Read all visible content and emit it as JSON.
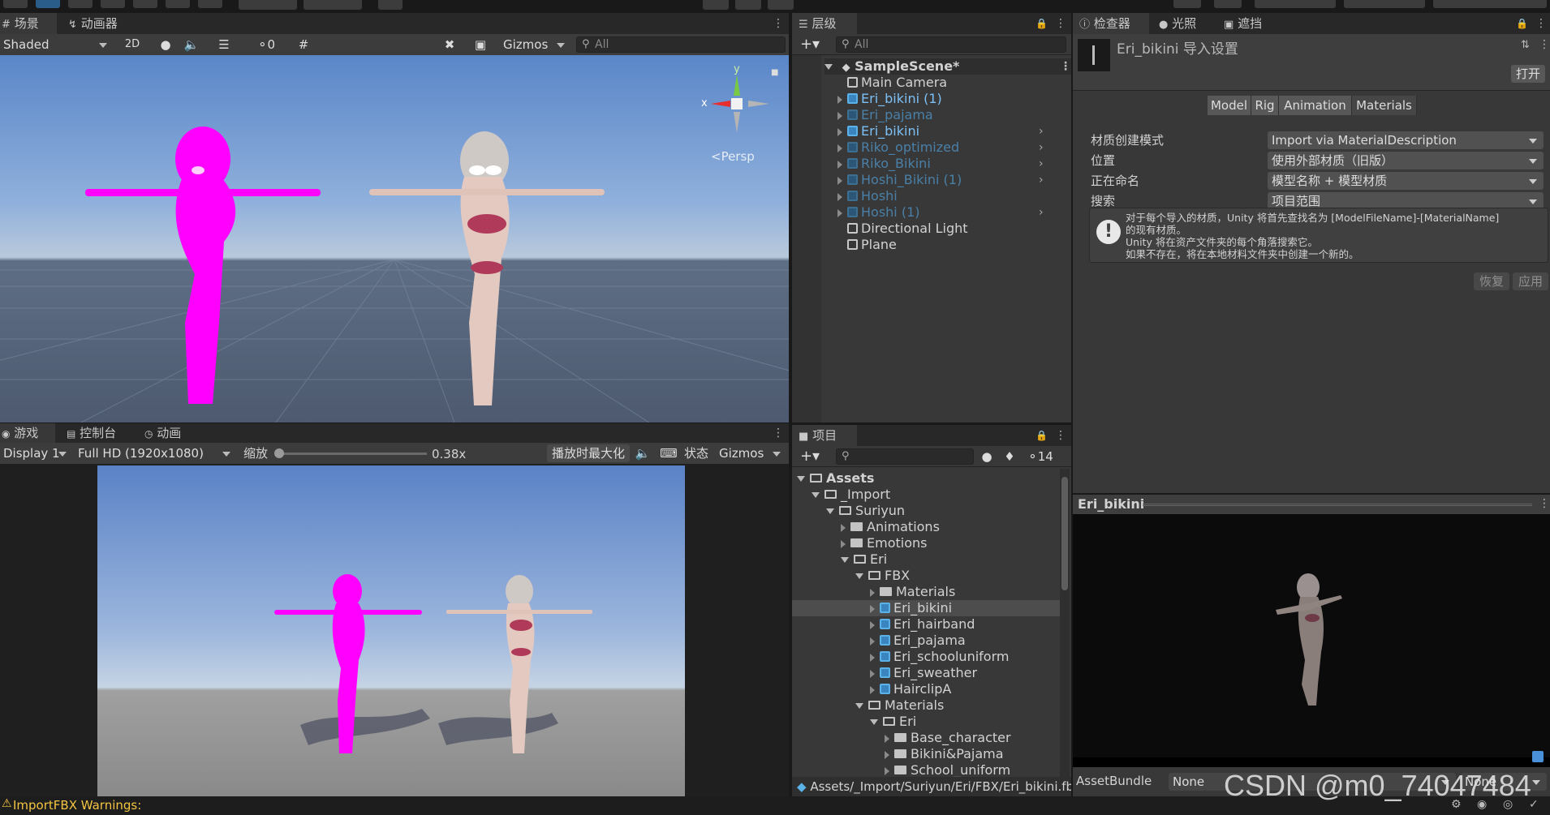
{
  "scene": {
    "tab_scene": "场景",
    "tab_animator": "动画器",
    "shading": "Shaded",
    "btn_2d": "2D",
    "hidden_count": "0",
    "gizmos": "Gizmos",
    "search_placeholder": "All",
    "persp": "<Persp",
    "axis_x": "x",
    "axis_y": "y"
  },
  "game": {
    "tab_game": "游戏",
    "tab_console": "控制台",
    "tab_animation": "动画",
    "display": "Display 1",
    "resolution": "Full HD (1920x1080)",
    "scale_label": "缩放",
    "scale_value": "0.38x",
    "scale_fraction": 0.0,
    "maximize": "播放时最大化",
    "stats": "状态",
    "gizmos": "Gizmos"
  },
  "hierarchy": {
    "tab": "层级",
    "search_placeholder": "All",
    "scene_name": "SampleScene*",
    "items": [
      {
        "label": "Main Camera",
        "style": "normal",
        "arrow": false
      },
      {
        "label": "Eri_bikini (1)",
        "style": "blue",
        "arrow": true
      },
      {
        "label": "Eri_pajama",
        "style": "dim",
        "arrow": true
      },
      {
        "label": "Eri_bikini",
        "style": "blue",
        "arrow": true
      },
      {
        "label": "Riko_optimized",
        "style": "dim",
        "arrow": true
      },
      {
        "label": "Riko_Bikini",
        "style": "dim",
        "arrow": true
      },
      {
        "label": "Hoshi_Bikini (1)",
        "style": "dim",
        "arrow": true
      },
      {
        "label": "Hoshi",
        "style": "dim",
        "arrow": true
      },
      {
        "label": "Hoshi (1)",
        "style": "dim",
        "arrow": true
      },
      {
        "label": "Directional Light",
        "style": "normal",
        "arrow": false
      },
      {
        "label": "Plane",
        "style": "normal",
        "arrow": false
      }
    ]
  },
  "project": {
    "tab": "项目",
    "hidden_count": "14",
    "tree": [
      {
        "label": "Assets",
        "depth": 0,
        "open": true,
        "icon": "folder",
        "bold": true
      },
      {
        "label": "_Import",
        "depth": 1,
        "open": true,
        "icon": "folder"
      },
      {
        "label": "Suriyun",
        "depth": 2,
        "open": true,
        "icon": "folder"
      },
      {
        "label": "Animations",
        "depth": 3,
        "open": false,
        "icon": "folder"
      },
      {
        "label": "Emotions",
        "depth": 3,
        "open": false,
        "icon": "folder"
      },
      {
        "label": "Eri",
        "depth": 3,
        "open": true,
        "icon": "folder"
      },
      {
        "label": "FBX",
        "depth": 4,
        "open": true,
        "icon": "folder"
      },
      {
        "label": "Materials",
        "depth": 5,
        "open": false,
        "icon": "folder"
      },
      {
        "label": "Eri_bikini",
        "depth": 5,
        "open": false,
        "icon": "model",
        "selected": true
      },
      {
        "label": "Eri_hairband",
        "depth": 5,
        "open": false,
        "icon": "model"
      },
      {
        "label": "Eri_pajama",
        "depth": 5,
        "open": false,
        "icon": "model"
      },
      {
        "label": "Eri_schooluniform",
        "depth": 5,
        "open": false,
        "icon": "model"
      },
      {
        "label": "Eri_sweather",
        "depth": 5,
        "open": false,
        "icon": "model"
      },
      {
        "label": "HairclipA",
        "depth": 5,
        "open": false,
        "icon": "model"
      },
      {
        "label": "Materials",
        "depth": 4,
        "open": true,
        "icon": "folder"
      },
      {
        "label": "Eri",
        "depth": 5,
        "open": true,
        "icon": "folder"
      },
      {
        "label": "Base_character",
        "depth": 6,
        "open": false,
        "icon": "folder"
      },
      {
        "label": "Bikini&Pajama",
        "depth": 6,
        "open": false,
        "icon": "folder"
      },
      {
        "label": "School_uniform",
        "depth": 6,
        "open": false,
        "icon": "folder"
      }
    ],
    "path": "Assets/_Import/Suriyun/Eri/FBX/Eri_bikini.fb"
  },
  "inspector": {
    "tab_inspector": "检查器",
    "tab_lighting": "光照",
    "tab_occlusion": "遮挡",
    "title": "Eri_bikini 导入设置",
    "open_btn": "打开",
    "tabs": [
      "Model",
      "Rig",
      "Animation",
      "Materials"
    ],
    "active_tab": 3,
    "rows": [
      {
        "label": "材质创建模式",
        "value": "Import via MaterialDescription"
      },
      {
        "label": "位置",
        "value": "使用外部材质（旧版）"
      },
      {
        "label": "正在命名",
        "value": "模型名称 + 模型材质"
      },
      {
        "label": "搜索",
        "value": "项目范围"
      }
    ],
    "info_lines": [
      "对于每个导入的材质，Unity 将首先查找名为 [ModelFileName]-[MaterialName]",
      "的现有材质。",
      "Unity 将在资产文件夹的每个角落搜索它。",
      "如果不存在，将在本地材料文件夹中创建一个新的。"
    ],
    "revert": "恢复",
    "apply": "应用",
    "preview_title": "Eri_bikini",
    "assetbundle_label": "AssetBundle",
    "assetbundle_value": "None",
    "assetbundle_variant": "None"
  },
  "status": {
    "message": "ImportFBX Warnings:"
  },
  "watermark": "CSDN @m0_74047484"
}
